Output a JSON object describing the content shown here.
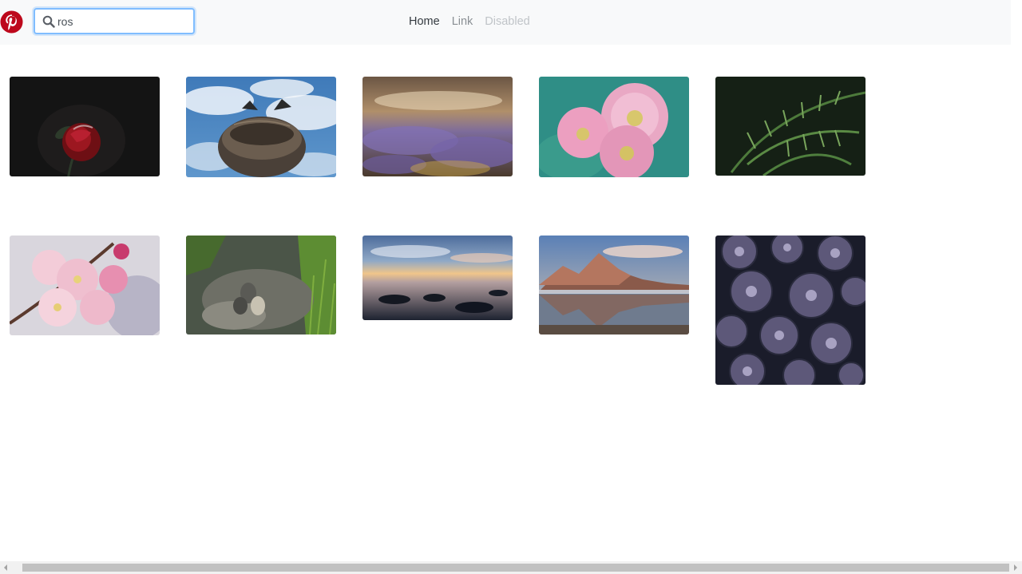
{
  "brand": {
    "logo_icon": "pinterest-logo-icon",
    "color": "#bd081c"
  },
  "search": {
    "value": "ros",
    "icon": "search-icon"
  },
  "nav": {
    "items": [
      {
        "label": "Home",
        "state": "active"
      },
      {
        "label": "Link",
        "state": "normal"
      },
      {
        "label": "Disabled",
        "state": "disabled"
      }
    ]
  },
  "gallery": {
    "items": [
      "red-rose-photo",
      "bird-nest-photo",
      "lavender-field-photo",
      "pink-dahlia-photo",
      "fern-leaves-photo",
      "cherry-blossom-photo",
      "bird-eggs-photo",
      "sunset-shore-photo",
      "mountain-lake-photo",
      "purple-succulents-photo"
    ]
  },
  "colors": {
    "navbar_bg": "#f8f9fa",
    "focus_border": "#80bdff"
  }
}
